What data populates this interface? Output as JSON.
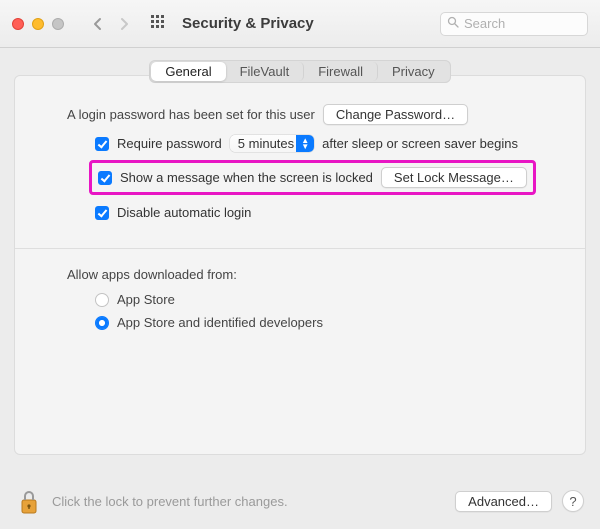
{
  "window": {
    "title": "Security & Privacy",
    "search_placeholder": "Search"
  },
  "tabs": {
    "general": "General",
    "filevault": "FileVault",
    "firewall": "Firewall",
    "privacy": "Privacy",
    "active": "general"
  },
  "general": {
    "login_text": "A login password has been set for this user",
    "change_password_btn": "Change Password…",
    "require_password": {
      "checked": true,
      "label": "Require password",
      "delay_value": "5 minutes",
      "suffix": "after sleep or screen saver begins"
    },
    "lock_message": {
      "checked": true,
      "label": "Show a message when the screen is locked",
      "button": "Set Lock Message…"
    },
    "disable_autologin": {
      "checked": true,
      "label": "Disable automatic login"
    },
    "allow_apps_label": "Allow apps downloaded from:",
    "allow_apps": {
      "selected": "identified",
      "appstore": "App Store",
      "identified": "App Store and identified developers"
    }
  },
  "footer": {
    "lock_text": "Click the lock to prevent further changes.",
    "advanced_btn": "Advanced…",
    "help": "?"
  }
}
